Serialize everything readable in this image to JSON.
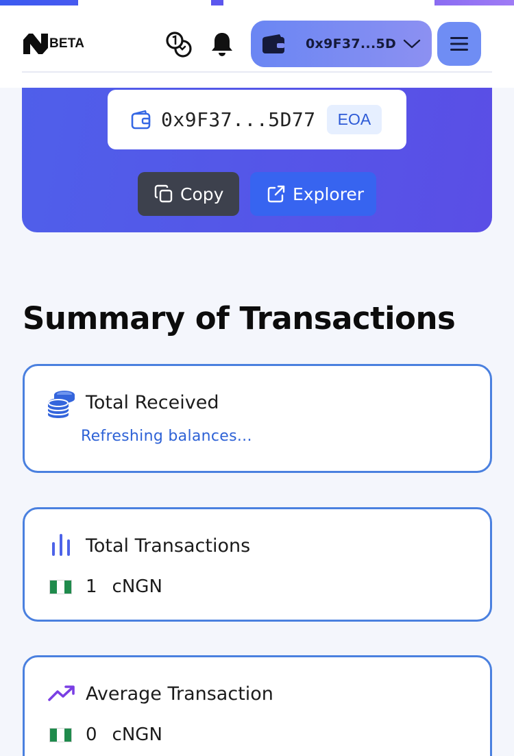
{
  "header": {
    "brand_badge": "BETA",
    "wallet_address_short": "0x9F37...5D"
  },
  "wallet_card": {
    "address": "0x9F37...5D77",
    "account_type": "EOA",
    "copy_label": "Copy",
    "explorer_label": "Explorer"
  },
  "summary": {
    "title": "Summary of Transactions",
    "cards": [
      {
        "title": "Total Received",
        "status": "Refreshing balances..."
      },
      {
        "title": "Total Transactions",
        "value": "1",
        "currency": "cNGN"
      },
      {
        "title": "Average Transaction",
        "value": "0",
        "currency": "cNGN"
      }
    ]
  },
  "icons": {
    "logo": "n-logo-icon",
    "swap": "coins-swap-icon",
    "notifications": "bell-icon",
    "wallet": "wallet-icon",
    "dropdown": "chevron-down-icon",
    "menu": "hamburger-menu-icon",
    "copy": "copy-icon",
    "explorer": "external-link-icon",
    "received": "coin-stack-icon",
    "transactions": "bar-chart-icon",
    "average": "trending-up-icon",
    "currency_flag": "nigeria-flag-icon"
  },
  "colors": {
    "accent_blue": "#3764f0",
    "hero_gradient_start": "#4f5fea",
    "hero_gradient_end": "#5a4ee6",
    "card_border": "#4a80df",
    "status_text": "#2e62d6",
    "flag_green": "#1f8b4c"
  }
}
